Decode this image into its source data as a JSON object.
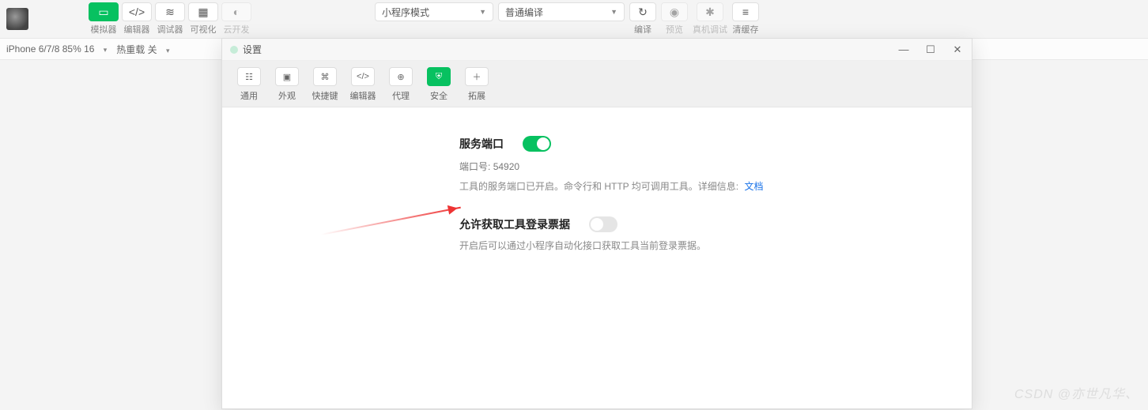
{
  "ide": {
    "toolbar": {
      "simulator": "模拟器",
      "editor": "编辑器",
      "debugger": "调试器",
      "visualize": "可视化",
      "cloud": "云开发"
    },
    "modeSelect": "小程序模式",
    "compileSelect": "普通编译",
    "actions": {
      "compile": "编译",
      "preview": "预览",
      "realDebug": "真机调试",
      "clearCache": "清缓存"
    },
    "deviceInfo": "iPhone 6/7/8 85% 16",
    "hotReload": "热重载 关"
  },
  "modal": {
    "title": "设置",
    "tabs": {
      "general": "通用",
      "appearance": "外观",
      "shortcut": "快捷键",
      "editor": "编辑器",
      "proxy": "代理",
      "security": "安全",
      "extension": "拓展"
    },
    "section1": {
      "title": "服务端口",
      "portLabel": "端口号:",
      "portValue": "54920",
      "hint": "工具的服务端口已开启。命令行和 HTTP 均可调用工具。详细信息:",
      "docLink": "文档"
    },
    "section2": {
      "title": "允许获取工具登录票据",
      "hint": "开启后可以通过小程序自动化接口获取工具当前登录票据。"
    }
  },
  "watermark": "CSDN @亦世凡华、"
}
